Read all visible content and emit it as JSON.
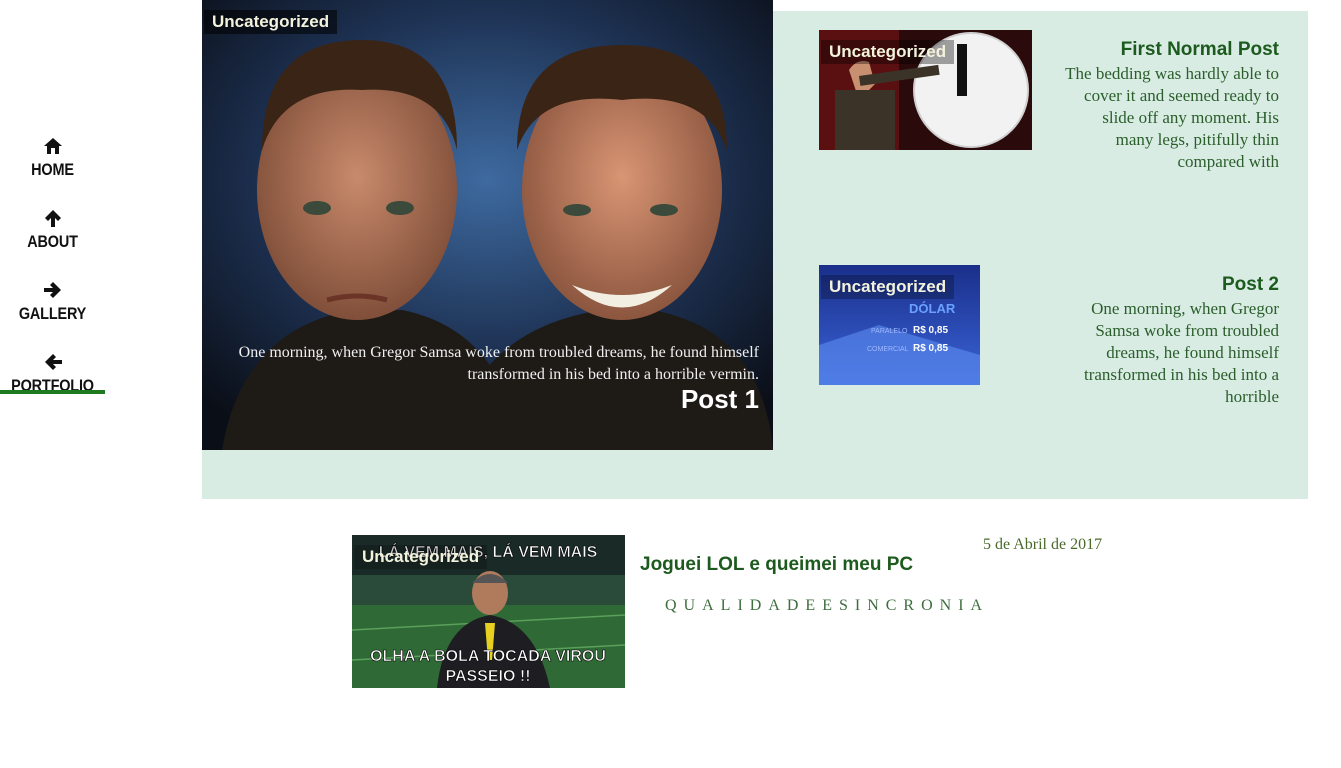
{
  "nav": {
    "items": [
      {
        "label": "HOME",
        "icon": "home-icon"
      },
      {
        "label": "ABOUT",
        "icon": "arrow-up-icon"
      },
      {
        "label": "GALLERY",
        "icon": "arrow-right-icon"
      },
      {
        "label": "PORTFOLIO",
        "icon": "arrow-left-icon"
      }
    ],
    "active_index": 3,
    "accent_color": "#1e7a1e"
  },
  "featured": {
    "background_color": "#d8ece4",
    "main": {
      "category": "Uncategorized",
      "excerpt": "One morning, when Gregor Samsa woke from troubled dreams, he found himself transformed in his bed into a horrible vermin.",
      "title": "Post 1"
    },
    "side_posts": [
      {
        "category": "Uncategorized",
        "title": "First Normal Post",
        "excerpt": "The bedding was hardly able to cover it and seemed ready to slide off any moment. His many legs, pitifully thin compared with"
      },
      {
        "category": "Uncategorized",
        "title": "Post 2",
        "excerpt": "One morning, when Gregor Samsa woke from troubled dreams, he found himself transformed in his bed into a horrible",
        "thumb_text": {
          "heading": "DÓLAR",
          "row1_label": "PARALELO",
          "row1_value": "R$  0,85",
          "row2_label": "COMERCIAL",
          "row2_value": "R$  0,85"
        }
      }
    ]
  },
  "latest": {
    "category": "Uncategorized",
    "title": "Joguei LOL e queimei meu PC",
    "date": "5 de Abril de 2017",
    "tag": "QUALIDADEESINCRONIA",
    "meme_top": "LÁ VEM MAIS, LÁ VEM MAIS",
    "meme_bottom_line1": "OLHA A BOLA TOCADA VIROU",
    "meme_bottom_line2": "PASSEIO !!"
  },
  "colors": {
    "title_green": "#1d5a1d",
    "text_green": "#2b5e2b"
  }
}
